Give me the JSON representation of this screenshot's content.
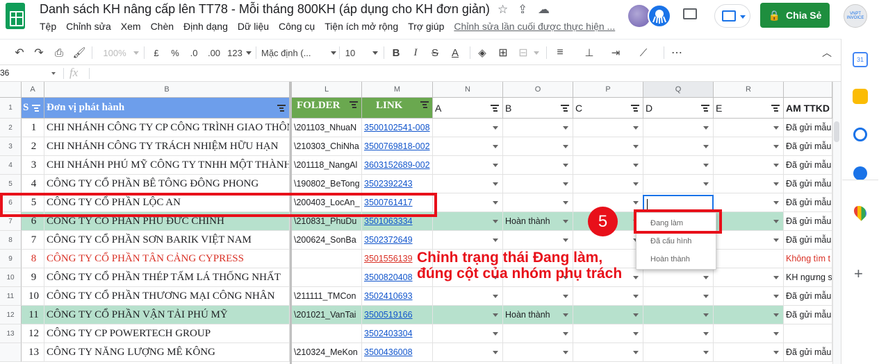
{
  "app": {
    "doc_title": "Danh sách KH nâng cấp lên TT78 - Mỗi tháng 800KH (áp dụng cho KH đơn giản)",
    "menu": [
      "Tệp",
      "Chỉnh sửa",
      "Xem",
      "Chèn",
      "Định dạng",
      "Dữ liệu",
      "Công cụ",
      "Tiện ích mở rộng",
      "Trợ giúp"
    ],
    "last_edit": "Chỉnh sửa lần cuối được thực hiện ...",
    "share_label": "Chia Sẻ",
    "brand_label": "VNPT INVOICE"
  },
  "toolbar": {
    "zoom": "100%",
    "currency": "£",
    "percent": "%",
    "dec_decrease": ".0",
    "dec_increase": ".00",
    "more_formats": "123",
    "font": "Mặc định (...",
    "font_size": "10",
    "bold": "B",
    "italic": "I",
    "strike": "S",
    "text_color": "A"
  },
  "formula_bar": {
    "name_box": "36",
    "fx": "fx"
  },
  "grid": {
    "col_letters": [
      "A",
      "B",
      "L",
      "M",
      "N",
      "O",
      "P",
      "Q",
      "R",
      ""
    ],
    "header_row": {
      "a": "S",
      "b": "Đơn vị phát hành",
      "l": "FOLDER",
      "m": "LINK",
      "n": "A",
      "o": "B",
      "p": "C",
      "q": "D",
      "r": "E",
      "s": "AM TTKD"
    },
    "row_numbers": [
      "1",
      "2",
      "3",
      "4",
      "5",
      "6",
      "7",
      "8",
      "9",
      "10",
      "11",
      "12",
      "13"
    ],
    "rows": [
      {
        "stt": "1",
        "name": "CHI NHÁNH CÔNG TY CP CÔNG TRÌNH GIAO THÔNG",
        "folder": "\\201103_NhuaN",
        "link": "3500102541-008",
        "o": "",
        "am": "Đã gửi mẫu"
      },
      {
        "stt": "2",
        "name": "CHI NHÁNH CÔNG TY TRÁCH NHIỆM HỮU HẠN",
        "folder": "\\210303_ChiNha",
        "link": "3500769818-002",
        "o": "",
        "am": "Đã gửi mẫu"
      },
      {
        "stt": "3",
        "name": "CHI NHÁNH PHÚ MỸ CÔNG TY TNHH MỘT THÀNH",
        "folder": "\\201118_NangAl",
        "link": "3603152689-002",
        "o": "",
        "am": "Đã gửi mẫu"
      },
      {
        "stt": "4",
        "name": "CÔNG TY CỔ PHẦN BÊ TÔNG ĐÔNG PHONG",
        "folder": "\\190802_BeTong",
        "link": "3502392243",
        "o": "",
        "am": "Đã gửi mẫu"
      },
      {
        "stt": "5",
        "name": "CÔNG TY CỔ PHẦN LỘC AN",
        "folder": "\\200403_LocAn_",
        "link": "3500761417",
        "o": "",
        "am": "Đã gửi mẫu"
      },
      {
        "stt": "6",
        "name": "CÔNG TY CỔ PHẦN PHÚ ĐỨC CHÍNH",
        "folder": "\\210831_PhuDu",
        "link": "3501063334",
        "o": "Hoàn thành",
        "am": "Đã gửi mẫu"
      },
      {
        "stt": "7",
        "name": "CÔNG TY CỔ PHẦN SƠN BARIK VIỆT NAM",
        "folder": "\\200624_SonBa",
        "link": "3502372649",
        "o": "",
        "am": "Đã gửi mẫu"
      },
      {
        "stt": "8",
        "name": "CÔNG TY CỔ PHẦN TÂN CẢNG CYPRESS",
        "folder": "",
        "link": "3501556139",
        "o": "",
        "am": "Không tìm t"
      },
      {
        "stt": "9",
        "name": "CÔNG TY CỔ PHẦN THÉP TẤM LÁ THỐNG NHẤT",
        "folder": "",
        "link": "3500820408",
        "o": "",
        "am": "KH ngưng s"
      },
      {
        "stt": "10",
        "name": "CÔNG TY CỔ PHẦN THƯƠNG MẠI CÔNG NHÂN",
        "folder": "\\211111_TMCon",
        "link": "3502410693",
        "o": "",
        "am": "Đã gửi mẫu"
      },
      {
        "stt": "11",
        "name": "CÔNG TY CỔ PHẦN VẬN TẢI PHÚ MỸ",
        "folder": "\\201021_VanTai",
        "link": "3500519166",
        "o": "Hoàn thành",
        "am": "Đã gửi mẫu"
      },
      {
        "stt": "12",
        "name": "CÔNG TY CP POWERTECH GROUP",
        "folder": "",
        "link": "3502403304",
        "o": "",
        "am": ""
      },
      {
        "stt": "13",
        "name": "CÔNG TY NĂNG LƯỢNG MÊ KÔNG",
        "folder": "\\210324_MeKon",
        "link": "3500436008",
        "o": "",
        "am": "Đã gửi mẫu"
      }
    ]
  },
  "dropdown": {
    "options": [
      "Đang làm",
      "Đã cấu hình",
      "Hoàn thành"
    ]
  },
  "annotation": {
    "step": "5",
    "line1": "Chỉnh trạng thái Đang làm,",
    "line2": "đúng cột của nhóm phụ trách"
  },
  "colors": {
    "header_blue": "#6d9eeb",
    "header_green": "#6aa84f",
    "done_row": "#b7e1cd",
    "annotation_red": "#e8101a",
    "link_blue": "#1155cc"
  }
}
